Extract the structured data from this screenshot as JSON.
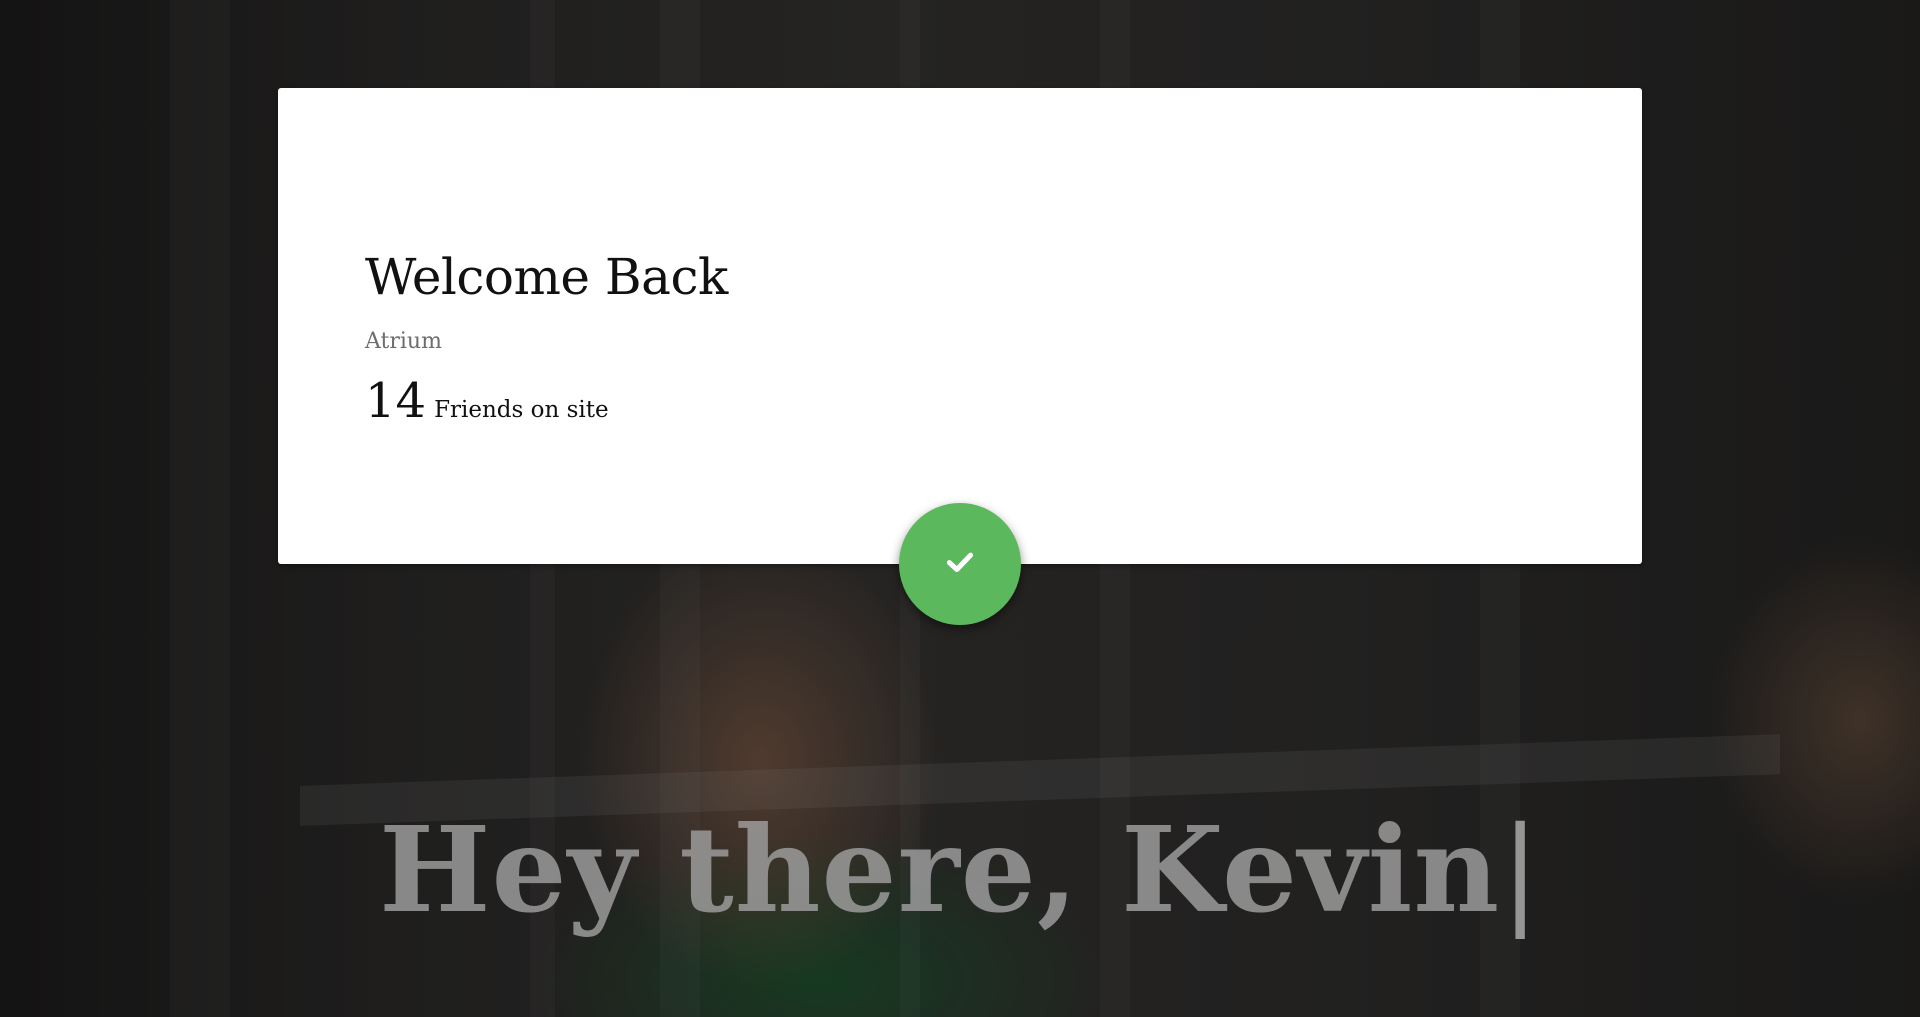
{
  "card": {
    "title": "Welcome Back",
    "location": "Atrium",
    "friends_count": "14",
    "friends_label": "Friends on site"
  },
  "confirm_button": {
    "icon": "checkmark-icon",
    "color": "#5cb85c"
  },
  "greeting": {
    "text": "Hey there, Kevin",
    "cursor": "|"
  }
}
